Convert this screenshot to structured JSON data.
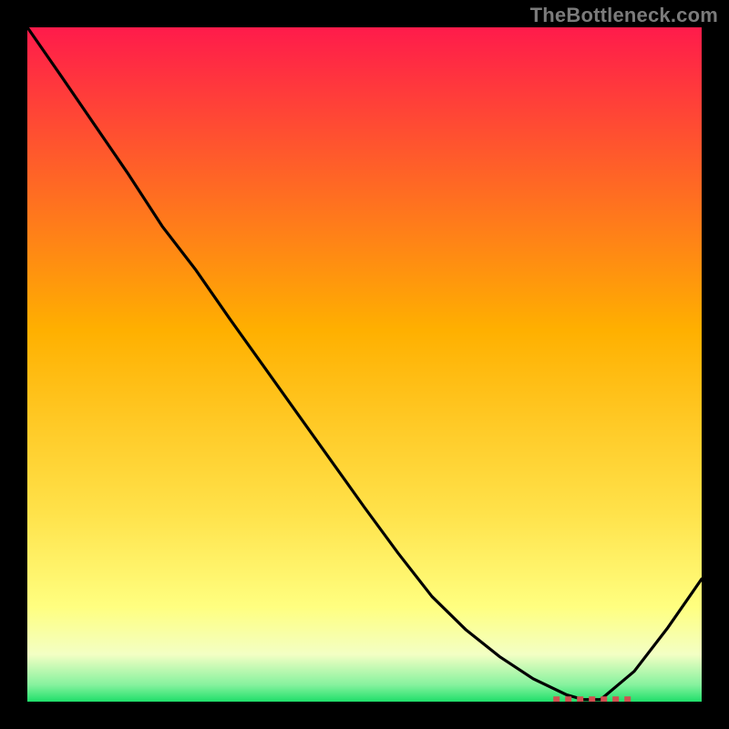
{
  "watermark": "TheBottleneck.com",
  "colors": {
    "bg": "#000000",
    "line": "#000000",
    "dash": "#d05050",
    "watermark": "#7b7b7b",
    "grad_top": "#ff1b4b",
    "grad_mid": "#ffc400",
    "grad_yellow": "#ffff66",
    "grad_pale": "#f6ffd0",
    "grad_green": "#1fdf6a"
  },
  "chart_data": {
    "type": "line",
    "x": [
      0.0,
      0.05,
      0.1,
      0.15,
      0.2,
      0.25,
      0.3,
      0.35,
      0.4,
      0.45,
      0.5,
      0.55,
      0.6,
      0.65,
      0.7,
      0.75,
      0.8,
      0.825,
      0.85,
      0.9,
      0.95,
      1.0
    ],
    "values": [
      1.0,
      0.928,
      0.855,
      0.782,
      0.705,
      0.64,
      0.568,
      0.498,
      0.428,
      0.358,
      0.288,
      0.22,
      0.156,
      0.107,
      0.067,
      0.034,
      0.01,
      0.003,
      0.003,
      0.045,
      0.11,
      0.182
    ],
    "title": "",
    "xlabel": "",
    "ylabel": "",
    "xlim": [
      0,
      1
    ],
    "ylim": [
      0,
      1
    ],
    "dash_segment": {
      "x0": 0.78,
      "x1": 0.9,
      "y": 0.003
    }
  }
}
